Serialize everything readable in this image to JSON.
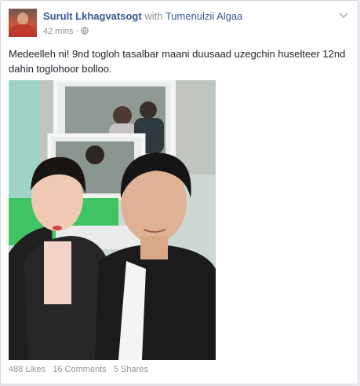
{
  "post": {
    "author": "Surult Lkhagvatsogt",
    "with_word": "with",
    "tagged": "Tumenulzii Algaa",
    "time": "42 mins",
    "separator": "·",
    "text": "Medeelleh ni! 9nd togloh tasalbar maani duusaad uzegchin huselteer 12nd dahin toglohoor bolloo."
  },
  "footer": {
    "likes": "488 Likes",
    "comments": "16 Comments",
    "shares": "5 Shares"
  },
  "icons": {
    "privacy": "globe-icon",
    "options": "chevron-down-icon"
  },
  "colors": {
    "link": "#365899",
    "meta": "#90949c",
    "text": "#1d2129"
  }
}
